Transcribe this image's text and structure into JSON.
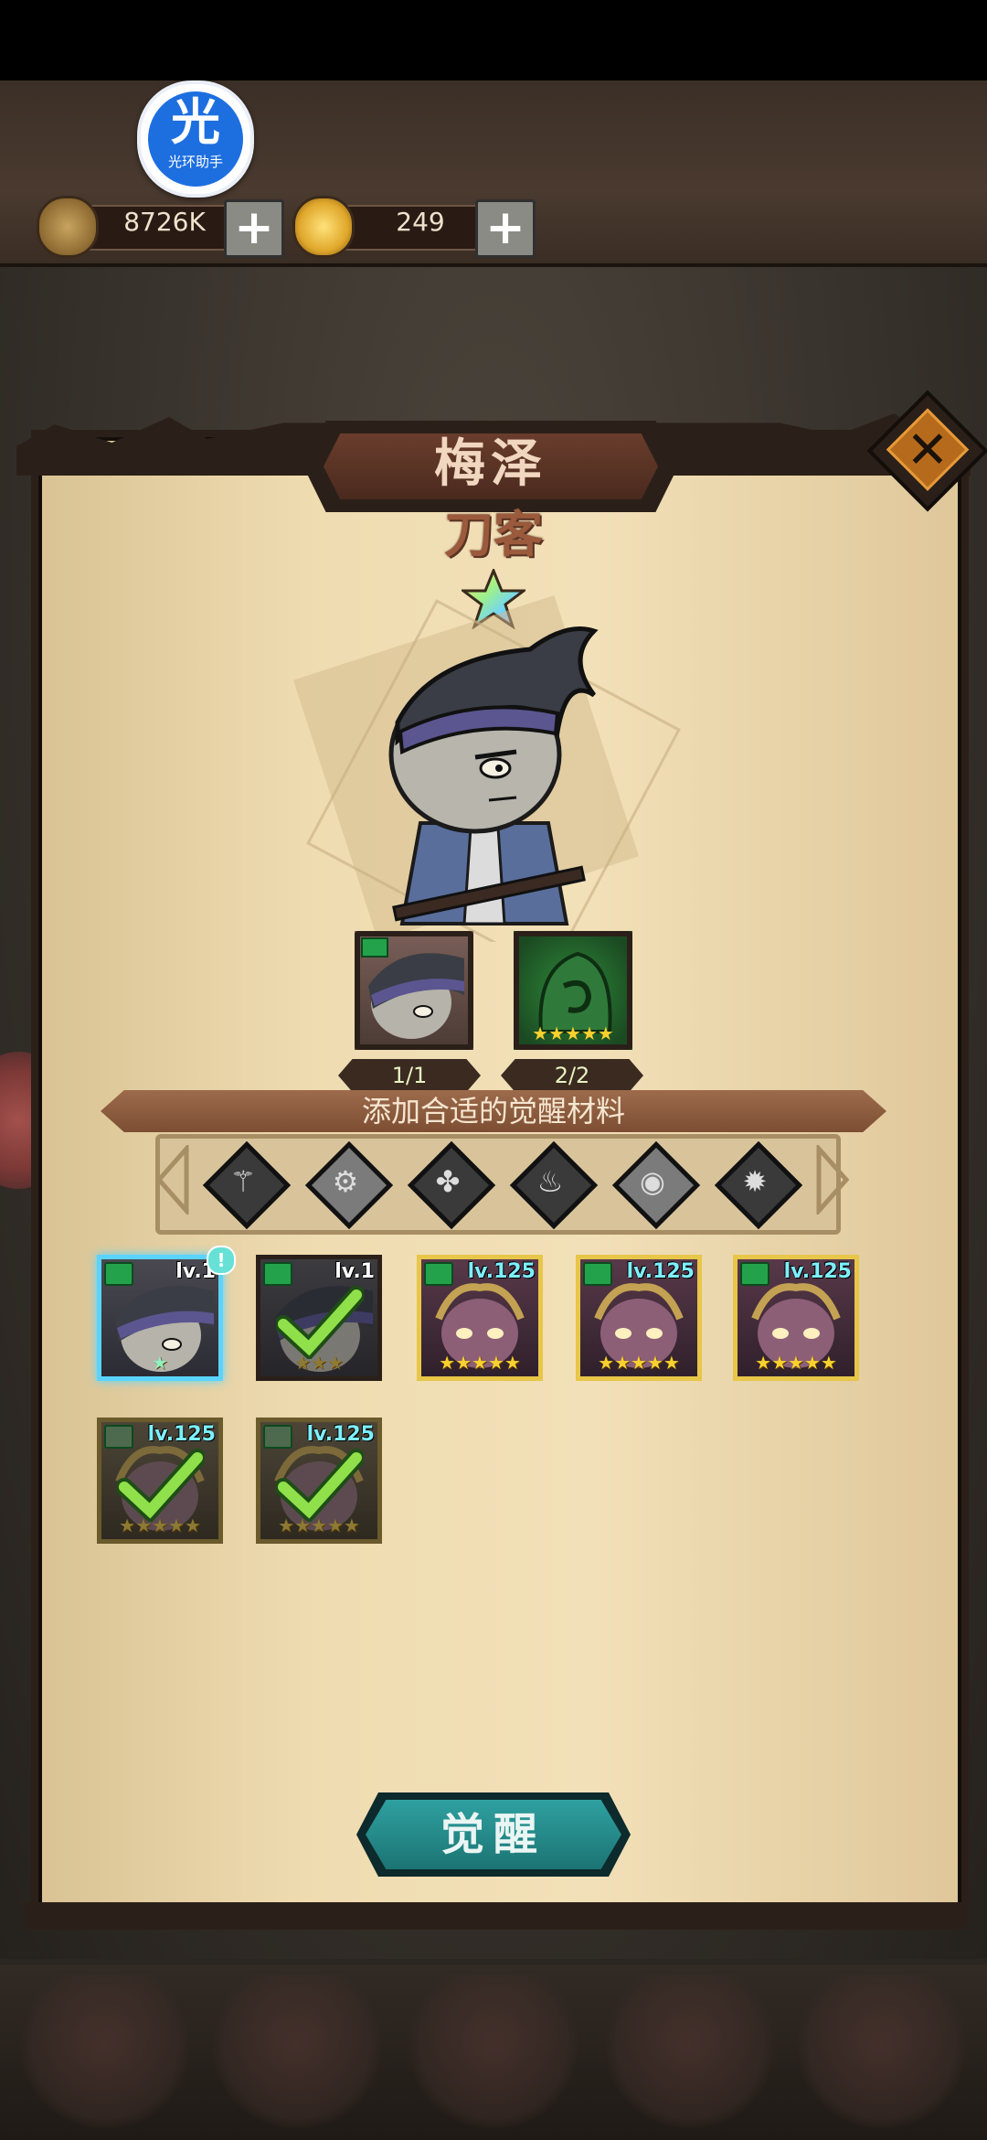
{
  "assistant_badge": {
    "glyph": "光",
    "name": "光环助手"
  },
  "resources": [
    {
      "icon": "gold-coin-icon",
      "value": "8726K"
    },
    {
      "icon": "gem-coin-icon",
      "value": "249"
    }
  ],
  "dialog": {
    "title": "梅泽",
    "class_name": "刀客",
    "hero_stars": 1,
    "materials": [
      {
        "icon": "hero-portrait-icon",
        "count": "1/1"
      },
      {
        "icon": "green-hood-fragment-icon",
        "count": "2/2",
        "stars": "★★★★★"
      }
    ],
    "banner_text": "添加合适的觉醒材料",
    "filters": [
      "symbol-a-icon",
      "gear-faction-icon",
      "clover-faction-icon",
      "flame-faction-icon",
      "eye-faction-icon",
      "dark-faction-icon"
    ],
    "cards": [
      {
        "level": "lv.1",
        "stars": "★",
        "state": "selected",
        "badge": "!"
      },
      {
        "level": "lv.1",
        "stars": "★★★",
        "state": "checked"
      },
      {
        "level": "lv.125",
        "stars": "★★★★★",
        "state": "available"
      },
      {
        "level": "lv.125",
        "stars": "★★★★★",
        "state": "available"
      },
      {
        "level": "lv.125",
        "stars": "★★★★★",
        "state": "available"
      },
      {
        "level": "lv.125",
        "stars": "★★★★★",
        "state": "checked"
      },
      {
        "level": "lv.125",
        "stars": "★★★★★",
        "state": "checked"
      }
    ],
    "awaken_button": "觉醒"
  },
  "colors": {
    "parchment": "#f2e0b8",
    "frame": "#2b2019",
    "accent_teal": "#2fa0a0",
    "selected_border": "#5ad4ff",
    "gold_border": "#e7c649"
  }
}
